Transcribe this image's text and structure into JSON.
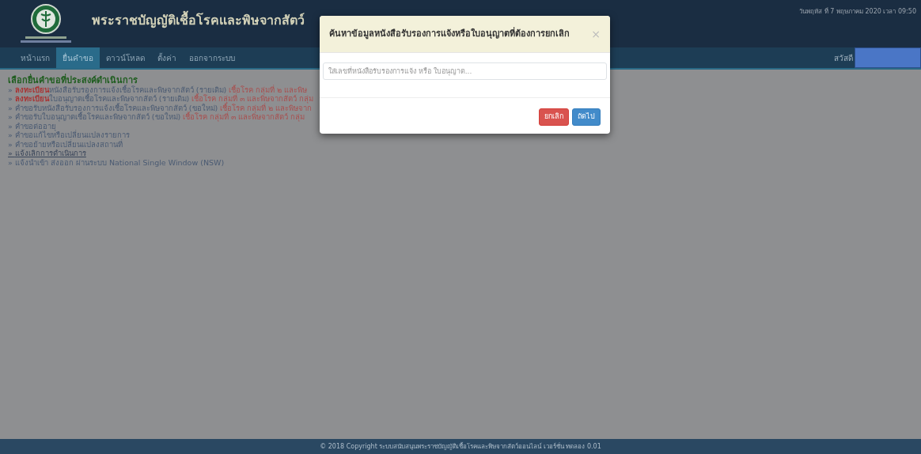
{
  "header": {
    "title": "พระราชบัญญัติเชื้อโรคและพิษจากสัตว์",
    "date": "วันพฤหัส ที่ 7 พฤษภาคม 2020 เวลา 09:50"
  },
  "nav": {
    "items": [
      {
        "label": "หน้าแรก",
        "selected": false
      },
      {
        "label": "ยื่นคำขอ",
        "selected": true
      },
      {
        "label": "ดาวน์โหลด",
        "selected": false
      },
      {
        "label": "ตั้งค่า",
        "selected": false
      },
      {
        "label": "ออกจากระบบ",
        "selected": false
      }
    ],
    "greeting": "สวัสดี"
  },
  "content": {
    "heading": "เลือกยื่นคำขอที่ประสงค์ดำเนินการ",
    "items": [
      {
        "marker": "»",
        "prefix": "ลงทะเบียน",
        "text": "หนังสือรับรองการแจ้งเชื้อโรคและพิษจากสัตว์ (รายเดิม)",
        "note": "เชื้อโรค กลุ่มที่ ๒ และพิษ",
        "underlined": false
      },
      {
        "marker": "»",
        "prefix": "ลงทะเบียน",
        "text": "ใบอนุญาตเชื้อโรคและพิษจากสัตว์ (รายเดิม)",
        "note": "เชื้อโรค กลุ่มที่ ๓ และพิษจากสัตว์ กลุ่ม",
        "underlined": false
      },
      {
        "marker": "»",
        "text": "คำขอรับหนังสือรับรองการแจ้งเชื้อโรคและพิษจากสัตว์ (ขอใหม่)",
        "note": "เชื้อโรค กลุ่มที่ ๒ และพิษจาก",
        "underlined": false
      },
      {
        "marker": "»",
        "text": "คำขอรับใบอนุญาตเชื้อโรคและพิษจากสัตว์ (ขอใหม่)",
        "note": "เชื้อโรค กลุ่มที่ ๓ และพิษจากสัตว์ กลุ่ม",
        "underlined": false
      },
      {
        "marker": "»",
        "text": "คำขอต่ออายุ",
        "underlined": false
      },
      {
        "marker": "»",
        "text": "คำขอแก้ไขหรือเปลี่ยนแปลงรายการ",
        "underlined": false
      },
      {
        "marker": "»",
        "text": "คำขอย้ายหรือเปลี่ยนแปลงสถานที่",
        "underlined": false
      },
      {
        "marker": "»",
        "text": "แจ้งเลิกการดำเนินการ",
        "underlined": true
      },
      {
        "marker": "»",
        "text": "แจ้งนำเข้า ส่งออก ผ่านระบบ National Single Window (NSW)",
        "underlined": false
      }
    ]
  },
  "modal": {
    "title": "ค้นหาข้อมูลหนังสือรับรองการแจ้งหรือใบอนุญาตที่ต้องการยกเลิก",
    "close": "×",
    "placeholder": "ใส่เลขที่หนังสือรับรองการแจ้ง หรือ ใบอนุญาต...",
    "buttons": [
      {
        "label": "ยกเลิก",
        "kind": "danger"
      },
      {
        "label": "ถัดไป",
        "kind": "primary"
      }
    ]
  },
  "footer": {
    "text": "© 2018 Copyright ระบบสนับสนุนพระราชบัญญัติเชื้อโรคและพิษจากสัตว์ออนไลน์ เวอร์ชั่น ทดลอง 0.01"
  }
}
